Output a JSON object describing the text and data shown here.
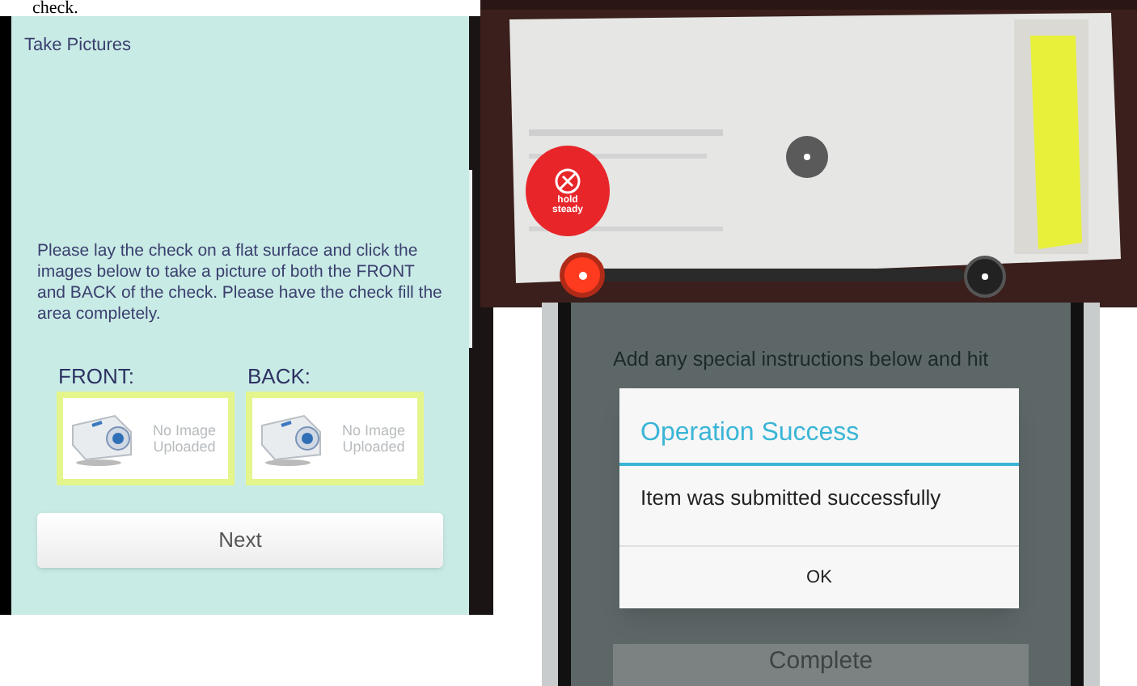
{
  "caption": {
    "text": "check."
  },
  "take_pictures": {
    "title": "Take Pictures",
    "instructions": "Please lay the check on a flat surface and click the images below to take a picture of both the FRONT and BACK of the check. Please have the check fill the area completely.",
    "slots": [
      {
        "label": "FRONT:",
        "status": "No Image Uploaded"
      },
      {
        "label": "BACK:",
        "status": "No Image Uploaded"
      }
    ],
    "next_button": "Next"
  },
  "camera": {
    "kind": "picture",
    "hint": "hold steady",
    "slider": {
      "level": 0.0
    }
  },
  "submit_screen": {
    "instructions": "Add any special instructions below and hit",
    "dialog": {
      "title": "Operation Success",
      "message": "Item was submitted successfully",
      "button": "OK"
    },
    "complete_button": "Complete"
  }
}
